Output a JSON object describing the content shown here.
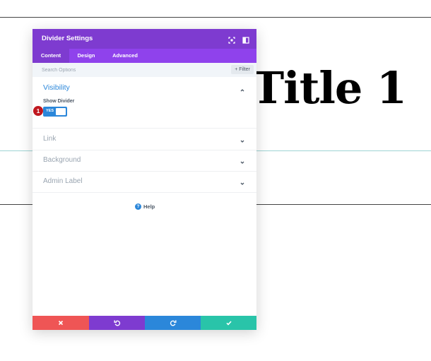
{
  "background": {
    "title": "Title 1"
  },
  "panel": {
    "title": "Divider Settings",
    "tabs": [
      {
        "label": "Content",
        "active": true
      },
      {
        "label": "Design",
        "active": false
      },
      {
        "label": "Advanced",
        "active": false
      }
    ],
    "search": {
      "placeholder": "Search Options",
      "filter_label": "+ Filter"
    },
    "sections": {
      "visibility": {
        "label": "Visibility",
        "expanded": true,
        "field_label": "Show Divider",
        "toggle_value": "YES"
      },
      "link": {
        "label": "Link"
      },
      "background": {
        "label": "Background"
      },
      "admin_label": {
        "label": "Admin Label"
      }
    },
    "help_label": "Help",
    "step_badge": "1"
  },
  "colors": {
    "header": "#7e3bd0",
    "tabs": "#8f42ec",
    "accent_blue": "#2b87da",
    "cancel": "#ef5555",
    "undo": "#7e3bd0",
    "redo": "#2b87da",
    "save": "#29c4a9"
  },
  "icons": [
    "expand-icon",
    "sidebar-icon",
    "chevron-up-icon",
    "chevron-down-icon",
    "help-icon",
    "close-icon",
    "undo-icon",
    "redo-icon",
    "check-icon"
  ]
}
